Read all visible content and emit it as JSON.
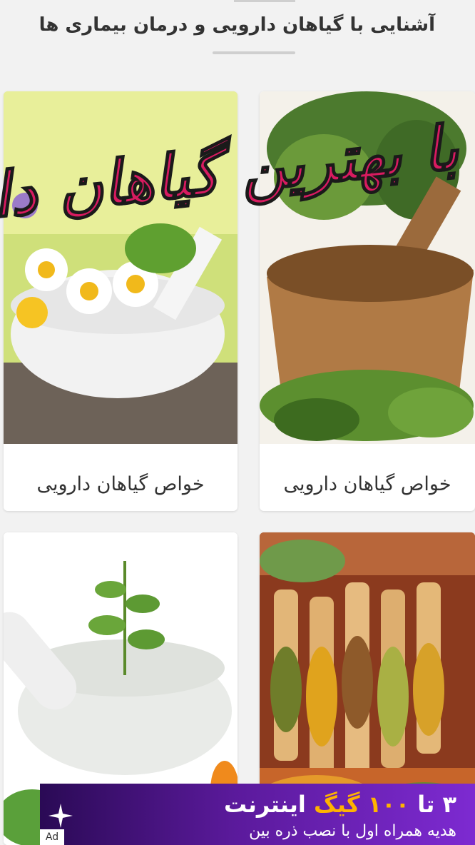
{
  "header": {
    "title": "آشنایی با گیاهان دارویی و درمان بیماری ها"
  },
  "banner": {
    "text": "با بهترین گیاهان دارویی"
  },
  "cards": [
    {
      "caption": "خواص گیاهان دارویی",
      "image": "herbs-mortar"
    },
    {
      "caption": "خواص گیاهان دارویی",
      "image": "chamomile-mortar"
    },
    {
      "caption": "",
      "image": "spices-scoops"
    },
    {
      "caption": "",
      "image": "mint-mortar"
    }
  ],
  "ad": {
    "line1_start": "۳ تا ",
    "line1_highlight": "۱۰۰ گیگ",
    "line1_end": " اینترنت",
    "line2": "هدیه همراه اول با نصب ذره بین",
    "badge": "Ad"
  }
}
